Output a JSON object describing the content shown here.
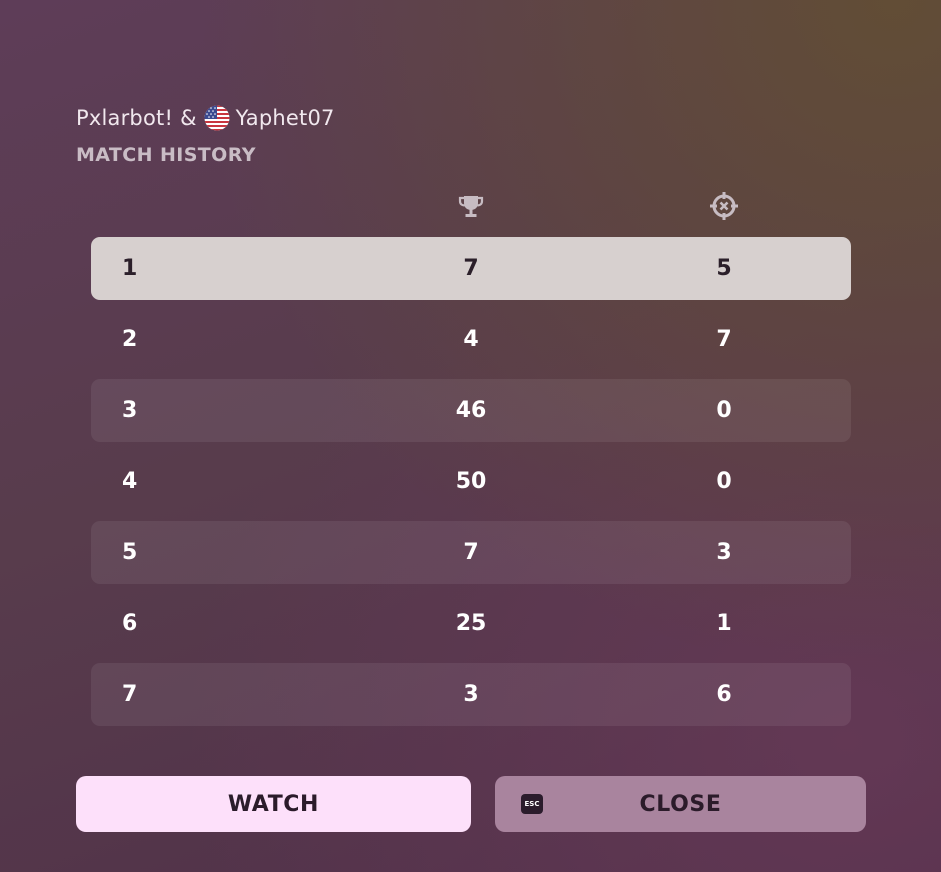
{
  "header": {
    "player1": "Pxlarbot!",
    "separator": "&",
    "player2": "Yaphet07",
    "player2_flag": "us-flag-icon",
    "subtitle": "MATCH HISTORY"
  },
  "columns": [
    {
      "icon": "trophy-icon"
    },
    {
      "icon": "crosshair-icon"
    }
  ],
  "rows": [
    {
      "index": "1",
      "trophies": "7",
      "kills": "5"
    },
    {
      "index": "2",
      "trophies": "4",
      "kills": "7"
    },
    {
      "index": "3",
      "trophies": "46",
      "kills": "0"
    },
    {
      "index": "4",
      "trophies": "50",
      "kills": "0"
    },
    {
      "index": "5",
      "trophies": "7",
      "kills": "3"
    },
    {
      "index": "6",
      "trophies": "25",
      "kills": "1"
    },
    {
      "index": "7",
      "trophies": "3",
      "kills": "6"
    }
  ],
  "selected_row": "1",
  "buttons": {
    "watch_label": "WATCH",
    "close_label": "CLOSE",
    "close_key": "ESC"
  },
  "colors": {
    "selected_row_bg": "#d7d0cf",
    "watch_button_bg": "#fde0fa",
    "close_button_bg": "#a9849e"
  }
}
